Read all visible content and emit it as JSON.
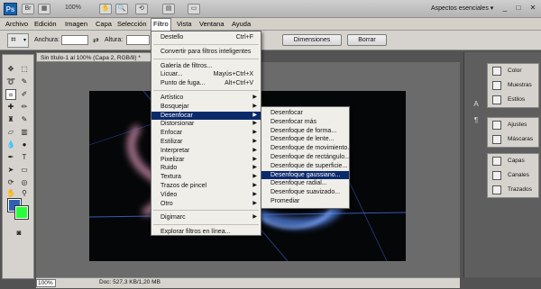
{
  "titlebar": {
    "logo": "Ps",
    "zoom": "100%",
    "workspace": "Aspectos esenciales",
    "workspace_arrow": "▾",
    "minimize": "_",
    "restore": "□",
    "close": "✕"
  },
  "menubar": {
    "items": [
      "Archivo",
      "Edición",
      "Imagen",
      "Capa",
      "Selección",
      "Filtro",
      "Vista",
      "Ventana",
      "Ayuda"
    ]
  },
  "options": {
    "width_label": "Anchura:",
    "height_label": "Altura:",
    "dimensions_button": "Dimensiones",
    "clear_button": "Borrar"
  },
  "document": {
    "tab_title": "Sin título-1 al 100% (Capa 2, RGB/8) *",
    "status_zoom": "100%",
    "status_doc": "Doc: 527,3 KB/1,20 MB"
  },
  "filter_menu": {
    "items": [
      {
        "label": "Destello",
        "shortcut": "Ctrl+F"
      },
      {
        "label": "Convertir para filtros inteligentes"
      },
      {
        "label": "Galería de filtros..."
      },
      {
        "label": "Licuar...",
        "shortcut": "Mayús+Ctrl+X"
      },
      {
        "label": "Punto de fuga...",
        "shortcut": "Alt+Ctrl+V"
      },
      {
        "label": "Artístico"
      },
      {
        "label": "Bosquejar"
      },
      {
        "label": "Desenfocar"
      },
      {
        "label": "Distorsionar"
      },
      {
        "label": "Enfocar"
      },
      {
        "label": "Estilizar"
      },
      {
        "label": "Interpretar"
      },
      {
        "label": "Pixelizar"
      },
      {
        "label": "Ruido"
      },
      {
        "label": "Textura"
      },
      {
        "label": "Trazos de pincel"
      },
      {
        "label": "Vídeo"
      },
      {
        "label": "Otro"
      },
      {
        "label": "Digimarc"
      },
      {
        "label": "Explorar filtros en línea..."
      }
    ]
  },
  "blur_submenu": {
    "items": [
      "Desenfocar",
      "Desenfocar más",
      "Desenfoque de forma...",
      "Desenfoque de lente...",
      "Desenfoque de movimiento...",
      "Desenfoque de rectángulo...",
      "Desenfoque de superficie...",
      "Desenfoque gaussiano...",
      "Desenfoque radial...",
      "Desenfoque suavizado...",
      "Promediar"
    ]
  },
  "panels": {
    "group1": [
      "Color",
      "Muestras",
      "Estilos"
    ],
    "group2": [
      "Ajustes",
      "Máscaras"
    ],
    "group3": [
      "Capas",
      "Canales",
      "Trazados"
    ]
  },
  "colors": {
    "foreground": "#2e61b4",
    "background": "#27ff3a",
    "highlight": "#0b2a6b"
  }
}
